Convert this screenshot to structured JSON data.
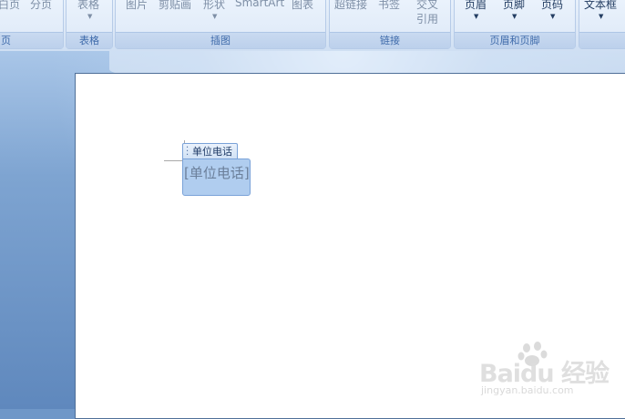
{
  "ribbon": {
    "groups": {
      "pages": {
        "label": "页",
        "items": [
          "白页",
          "分页"
        ]
      },
      "tables": {
        "label": "表格",
        "item": "表格"
      },
      "illustrations": {
        "label": "插图",
        "items": [
          "图片",
          "剪贴画",
          "形状",
          "SmartArt",
          "图表"
        ]
      },
      "links": {
        "label": "链接",
        "items": [
          "超链接",
          "书签",
          "交叉",
          "引用"
        ]
      },
      "header_footer": {
        "label": "页眉和页脚",
        "items": [
          "页眉",
          "页脚",
          "页码"
        ]
      },
      "text": {
        "item": "文本框"
      }
    }
  },
  "document": {
    "content_control_title": "单位电话",
    "content_control_placeholder": "[单位电话]"
  },
  "watermark": {
    "brand": "Baidu 经验",
    "url": "jingyan.baidu.com"
  },
  "icons": {
    "grip": "drag-handle-icon",
    "dropdown": "chevron-down-icon",
    "logo": "baidu-paw-icon"
  }
}
